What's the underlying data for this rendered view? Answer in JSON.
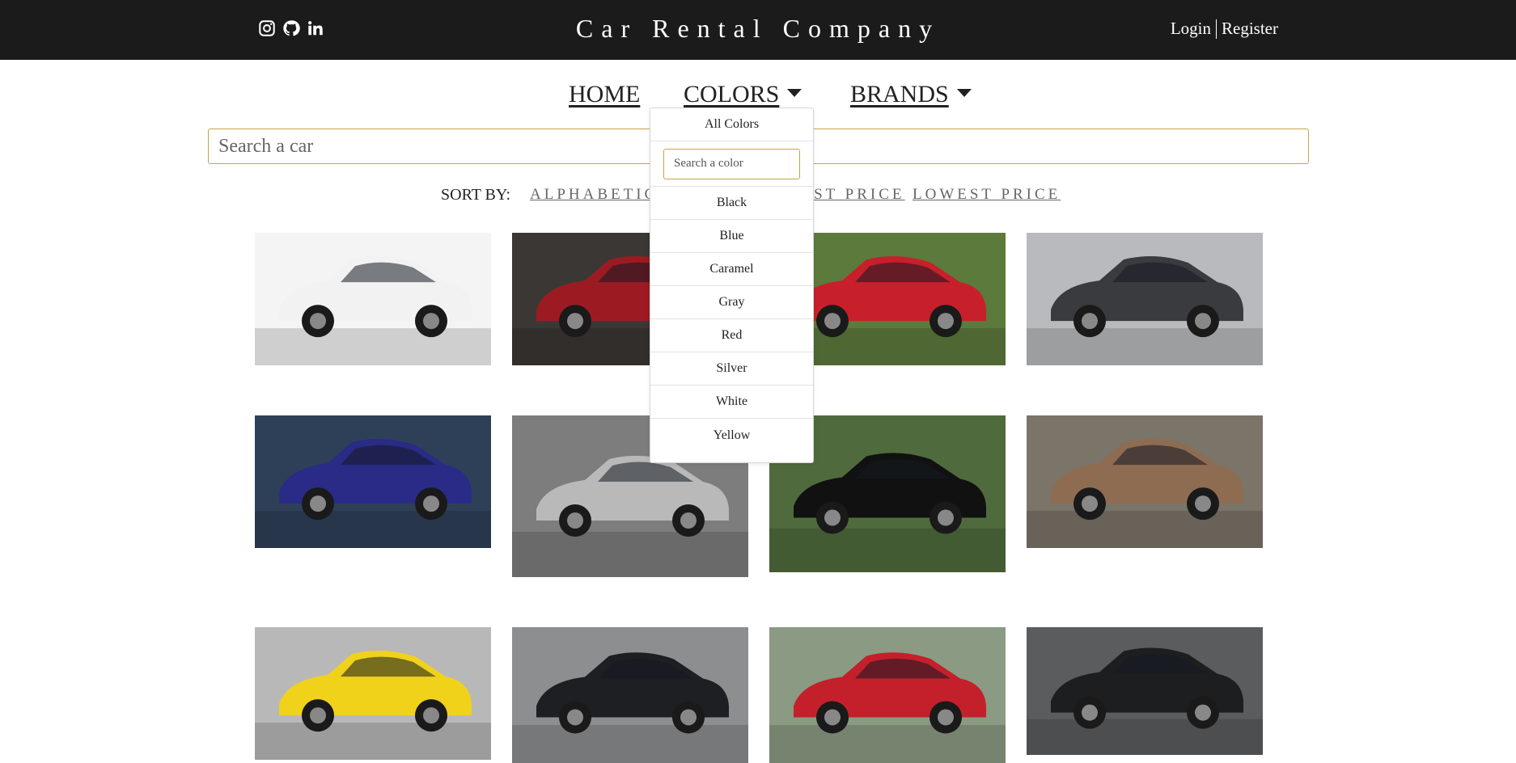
{
  "header": {
    "title": "Car Rental Company",
    "social_icons": [
      "instagram-icon",
      "github-icon",
      "linkedin-icon"
    ],
    "login_label": "Login",
    "register_label": "Register"
  },
  "nav": {
    "home_label": "HOME",
    "colors_label": "COLORS",
    "brands_label": "BRANDS"
  },
  "search": {
    "placeholder": "Search a car",
    "value": ""
  },
  "sort": {
    "label": "SORT BY:",
    "options": [
      "ALPHABETICAL",
      "HIGHEST PRICE",
      "LOWEST PRICE"
    ]
  },
  "colors_dropdown": {
    "all_label": "All Colors",
    "search_placeholder": "Search a color",
    "options": [
      "Black",
      "Blue",
      "Caramel",
      "Gray",
      "Red",
      "Silver",
      "White",
      "Yellow"
    ]
  },
  "cars": [
    {
      "color_name": "White",
      "body": "#f2f2f2",
      "bg": "#f4f4f4"
    },
    {
      "color_name": "Red",
      "body": "#9c1b22",
      "bg": "#3b3734"
    },
    {
      "color_name": "Red",
      "body": "#c8202a",
      "bg": "#5c7a3c"
    },
    {
      "color_name": "Gray",
      "body": "#3a3b3e",
      "bg": "#b9babd"
    },
    {
      "color_name": "Blue",
      "body": "#2a2b86",
      "bg": "#2e4058"
    },
    {
      "color_name": "Silver",
      "body": "#b9b9b9",
      "bg": "#7d7d7d"
    },
    {
      "color_name": "Black",
      "body": "#111111",
      "bg": "#4f6b3d"
    },
    {
      "color_name": "Caramel",
      "body": "#8e6c52",
      "bg": "#7b7468"
    },
    {
      "color_name": "Yellow",
      "body": "#f0d21a",
      "bg": "#b8b8b8"
    },
    {
      "color_name": "Black",
      "body": "#1e1f22",
      "bg": "#8c8e90"
    },
    {
      "color_name": "Red",
      "body": "#c4202b",
      "bg": "#8b9a82"
    },
    {
      "color_name": "Black",
      "body": "#1d1e20",
      "bg": "#5a5c5e"
    }
  ]
}
